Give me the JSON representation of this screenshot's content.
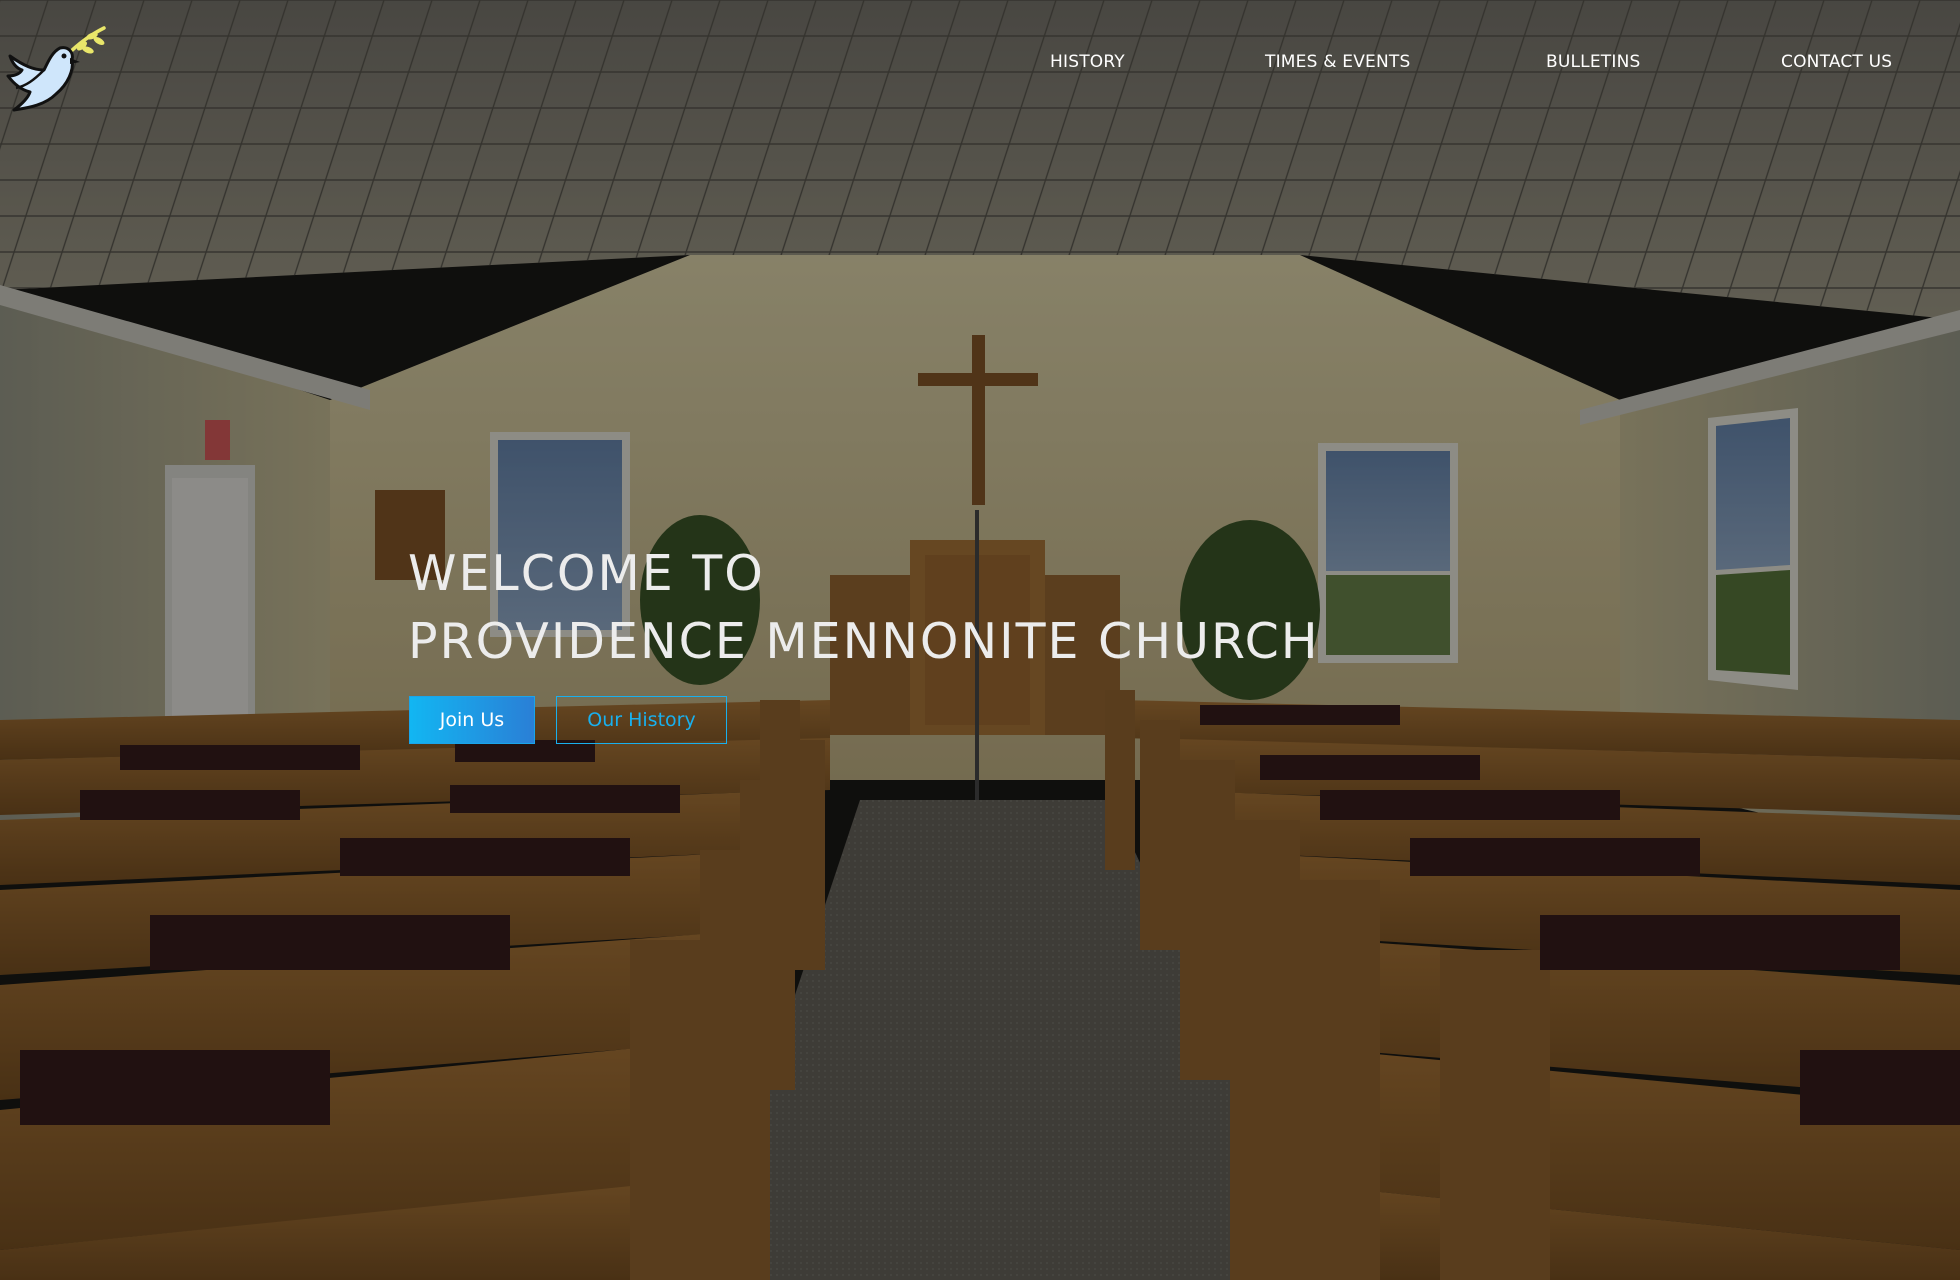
{
  "header": {
    "logo_icon": "dove-with-olive-branch-icon",
    "nav": [
      {
        "label": "HISTORY"
      },
      {
        "label": "TIMES & EVENTS"
      },
      {
        "label": "BULLETINS"
      },
      {
        "label": "CONTACT US"
      }
    ]
  },
  "hero": {
    "headline_line1": "WELCOME TO",
    "headline_line2": "PROVIDENCE MENNONITE CHURCH",
    "join_label": "Join Us",
    "history_label": "Our History",
    "background": "church-sanctuary-interior-photo"
  },
  "colors": {
    "accent": "#19b0ee",
    "button_gradient_start": "#12b6f2",
    "button_gradient_end": "#2a7fd6",
    "nav_text": "#ffffff",
    "headline_text": "#ececec"
  }
}
